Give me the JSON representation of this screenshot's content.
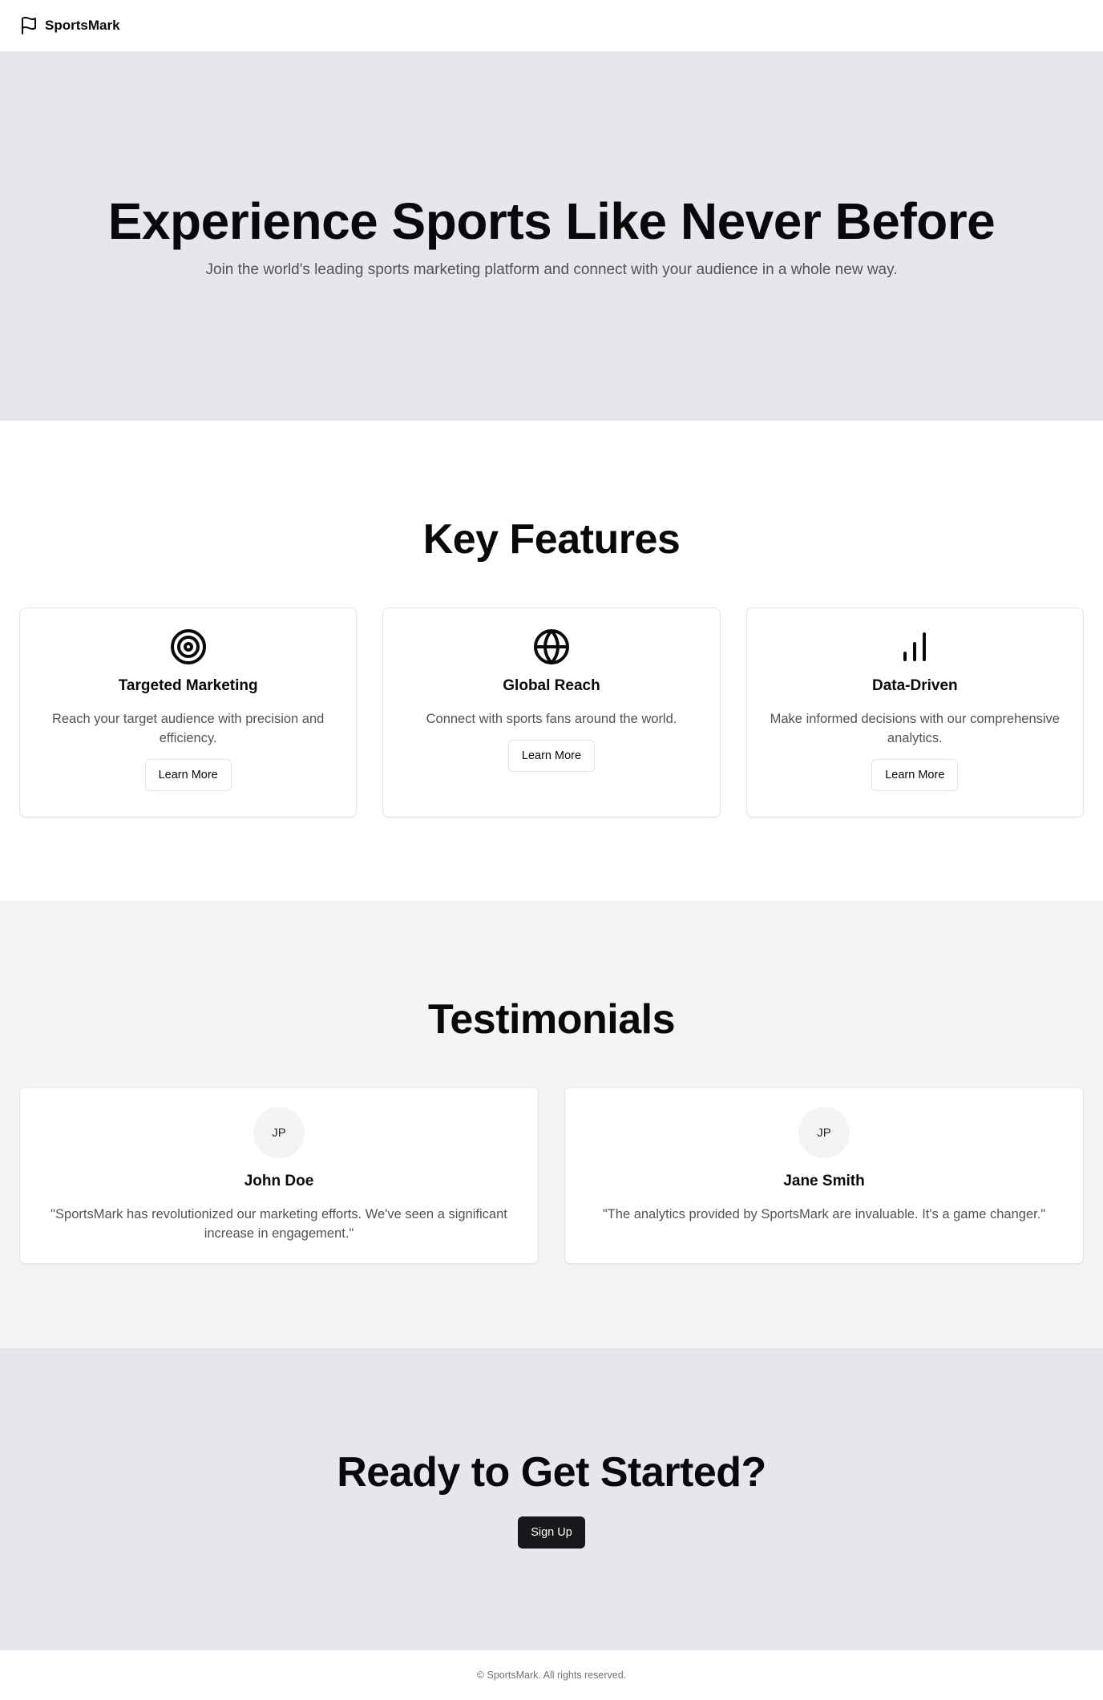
{
  "header": {
    "brand": "SportsMark",
    "logo_icon": "flag-icon"
  },
  "hero": {
    "title": "Experience Sports Like Never Before",
    "subtitle": "Join the world's leading sports marketing platform and connect with your audience in a whole new way."
  },
  "features": {
    "title": "Key Features",
    "items": [
      {
        "icon": "target-icon",
        "title": "Targeted Marketing",
        "description": "Reach your target audience with precision and efficiency.",
        "button": "Learn More"
      },
      {
        "icon": "globe-icon",
        "title": "Global Reach",
        "description": "Connect with sports fans around the world.",
        "button": "Learn More"
      },
      {
        "icon": "bar-chart-icon",
        "title": "Data-Driven",
        "description": "Make informed decisions with our comprehensive analytics.",
        "button": "Learn More"
      }
    ]
  },
  "testimonials": {
    "title": "Testimonials",
    "items": [
      {
        "initials": "JP",
        "name": "John Doe",
        "quote": "\"SportsMark has revolutionized our marketing efforts. We've seen a significant increase in engagement.\""
      },
      {
        "initials": "JP",
        "name": "Jane Smith",
        "quote": "\"The analytics provided by SportsMark are invaluable. It's a game changer.\""
      }
    ]
  },
  "cta": {
    "title": "Ready to Get Started?",
    "button": "Sign Up"
  },
  "footer": {
    "text": "© SportsMark. All rights reserved."
  }
}
